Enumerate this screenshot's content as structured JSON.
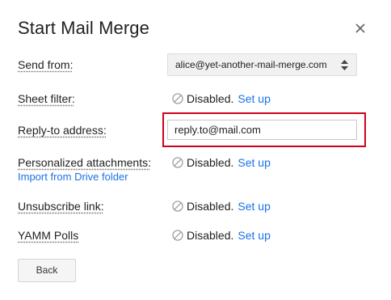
{
  "dialog": {
    "title": "Start Mail Merge",
    "close_icon": "close-icon"
  },
  "send_from": {
    "label": "Send from:",
    "selected_value": "alice@yet-another-mail-merge.com",
    "arrow_icon": "select-arrows-icon"
  },
  "sheet_filter": {
    "label": "Sheet filter:",
    "status": "Disabled.",
    "link": "Set up",
    "icon": "disabled-icon"
  },
  "reply_to": {
    "label": "Reply-to address:",
    "value": "reply.to@mail.com",
    "highlight_color": "#d0021b"
  },
  "attachments": {
    "label": "Personalized attachments:",
    "import_link": "Import from Drive folder",
    "status": "Disabled.",
    "link": "Set up",
    "icon": "disabled-icon"
  },
  "unsubscribe": {
    "label": "Unsubscribe link:",
    "status": "Disabled.",
    "link": "Set up",
    "icon": "disabled-icon"
  },
  "polls": {
    "label": "YAMM Polls",
    "status": "Disabled.",
    "link": "Set up",
    "icon": "disabled-icon"
  },
  "footer": {
    "back_label": "Back"
  },
  "colors": {
    "link": "#1a73e8",
    "text": "#222222"
  }
}
